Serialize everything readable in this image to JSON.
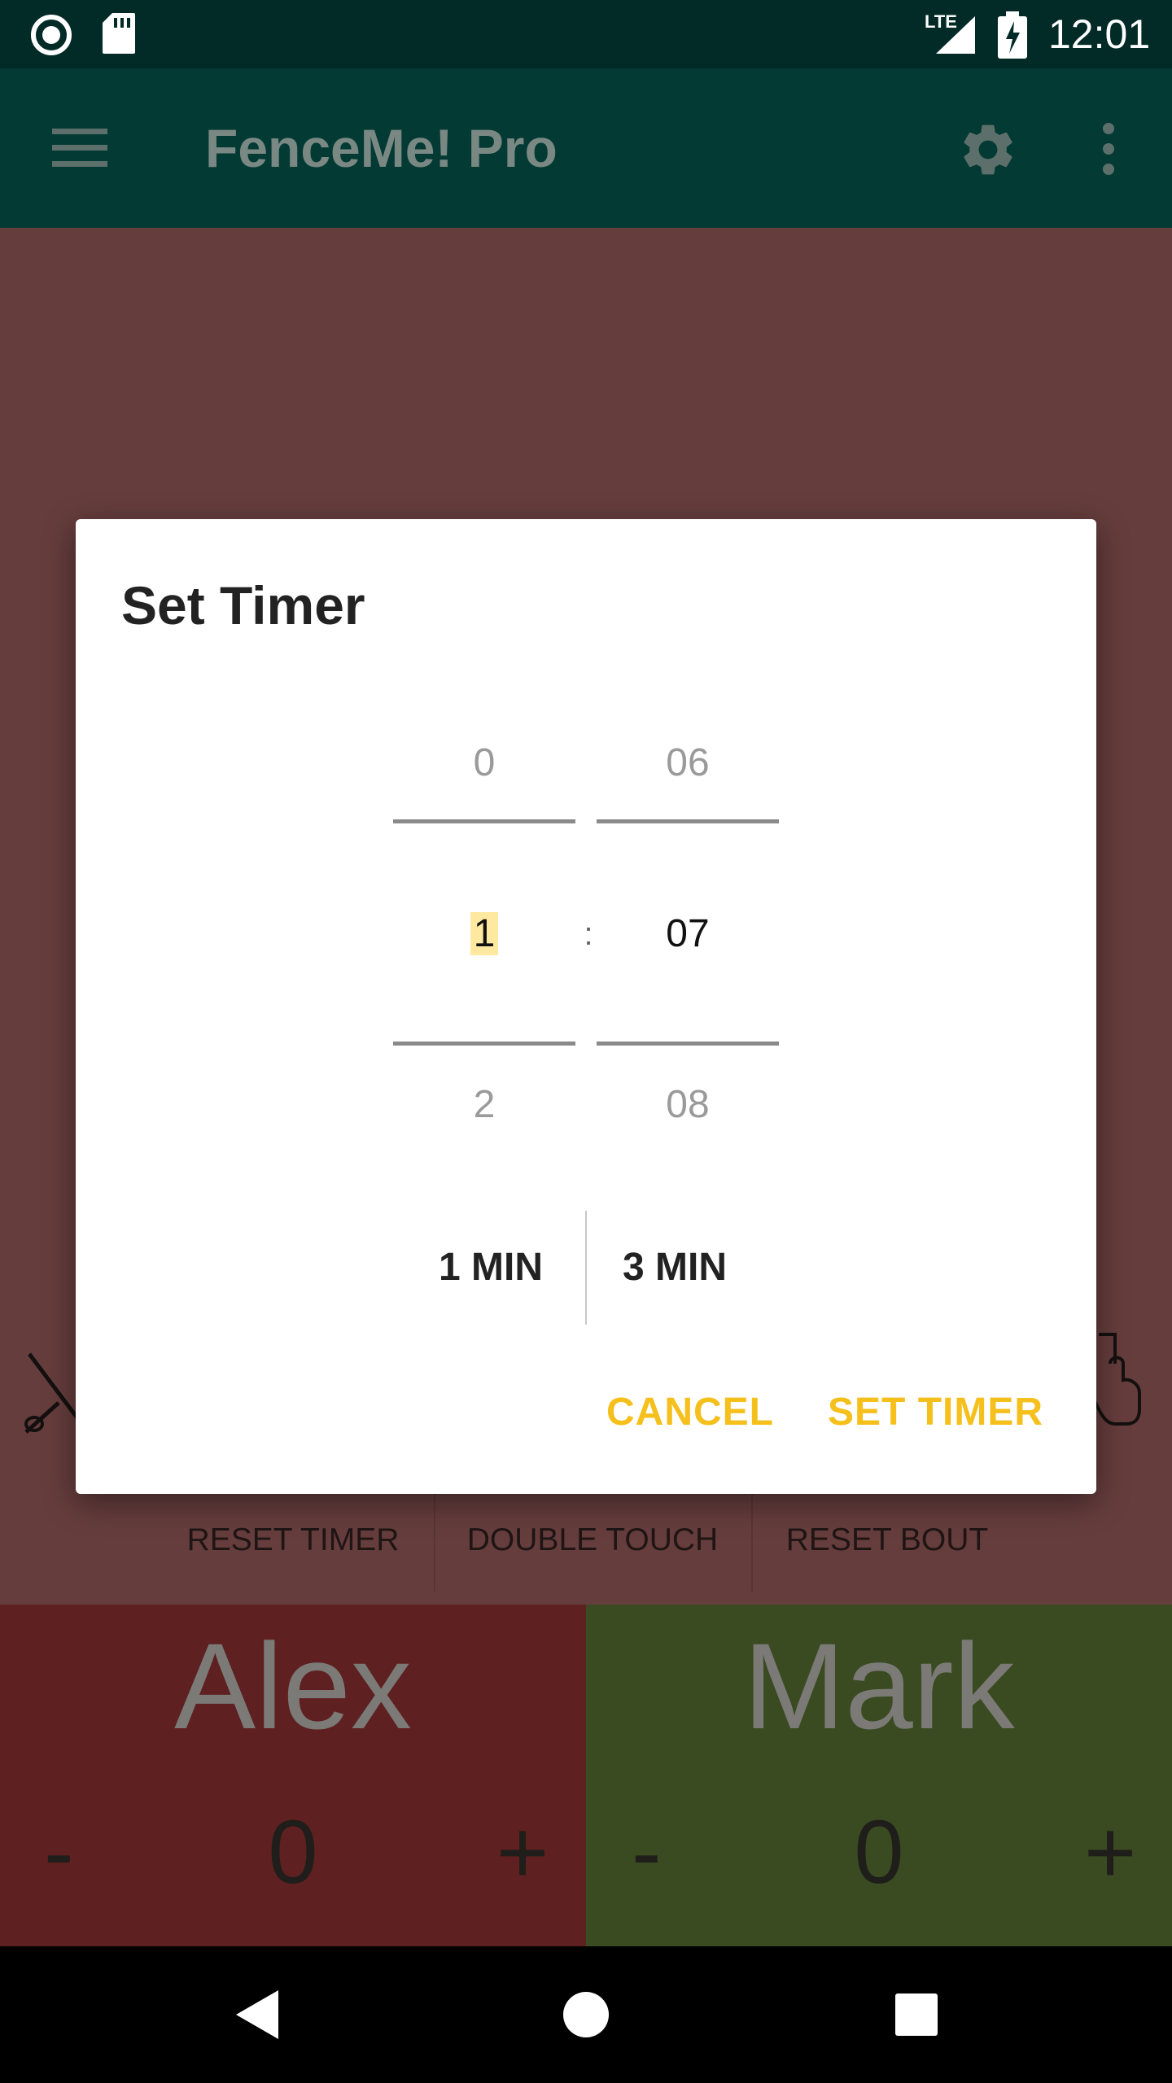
{
  "status_bar": {
    "time": "12:01",
    "network": "LTE",
    "icons": [
      "record-icon",
      "sd-card-icon",
      "signal-icon",
      "battery-charging-icon"
    ]
  },
  "app_bar": {
    "title": "FenceMe! Pro",
    "icons": [
      "menu-icon",
      "settings-icon",
      "more-vert-icon"
    ]
  },
  "dialog": {
    "title": "Set Timer",
    "minutes": {
      "prev": "0",
      "selected": "1",
      "next": "2"
    },
    "separator": ":",
    "seconds": {
      "prev": "06",
      "selected": "07",
      "next": "08"
    },
    "presets": [
      "1 MIN",
      "3 MIN"
    ],
    "cancel_label": "CANCEL",
    "confirm_label": "SET TIMER"
  },
  "controls": {
    "reset_timer": "RESET TIMER",
    "double_touch": "DOUBLE TOUCH",
    "reset_bout": "RESET BOUT"
  },
  "fencers": {
    "left": {
      "name": "Alex",
      "score": "0",
      "minus": "-",
      "plus": "+"
    },
    "right": {
      "name": "Mark",
      "score": "0",
      "minus": "-",
      "plus": "+"
    }
  },
  "colors": {
    "status_bar": "#022b27",
    "app_bar": "#033a33",
    "background_dimmed": "#663d3d",
    "left_panel": "#5e2020",
    "right_panel": "#3a4b22",
    "accent": "#f5bf1c"
  },
  "nav_bar": {
    "icons": [
      "back-icon",
      "home-icon",
      "recents-icon"
    ]
  }
}
